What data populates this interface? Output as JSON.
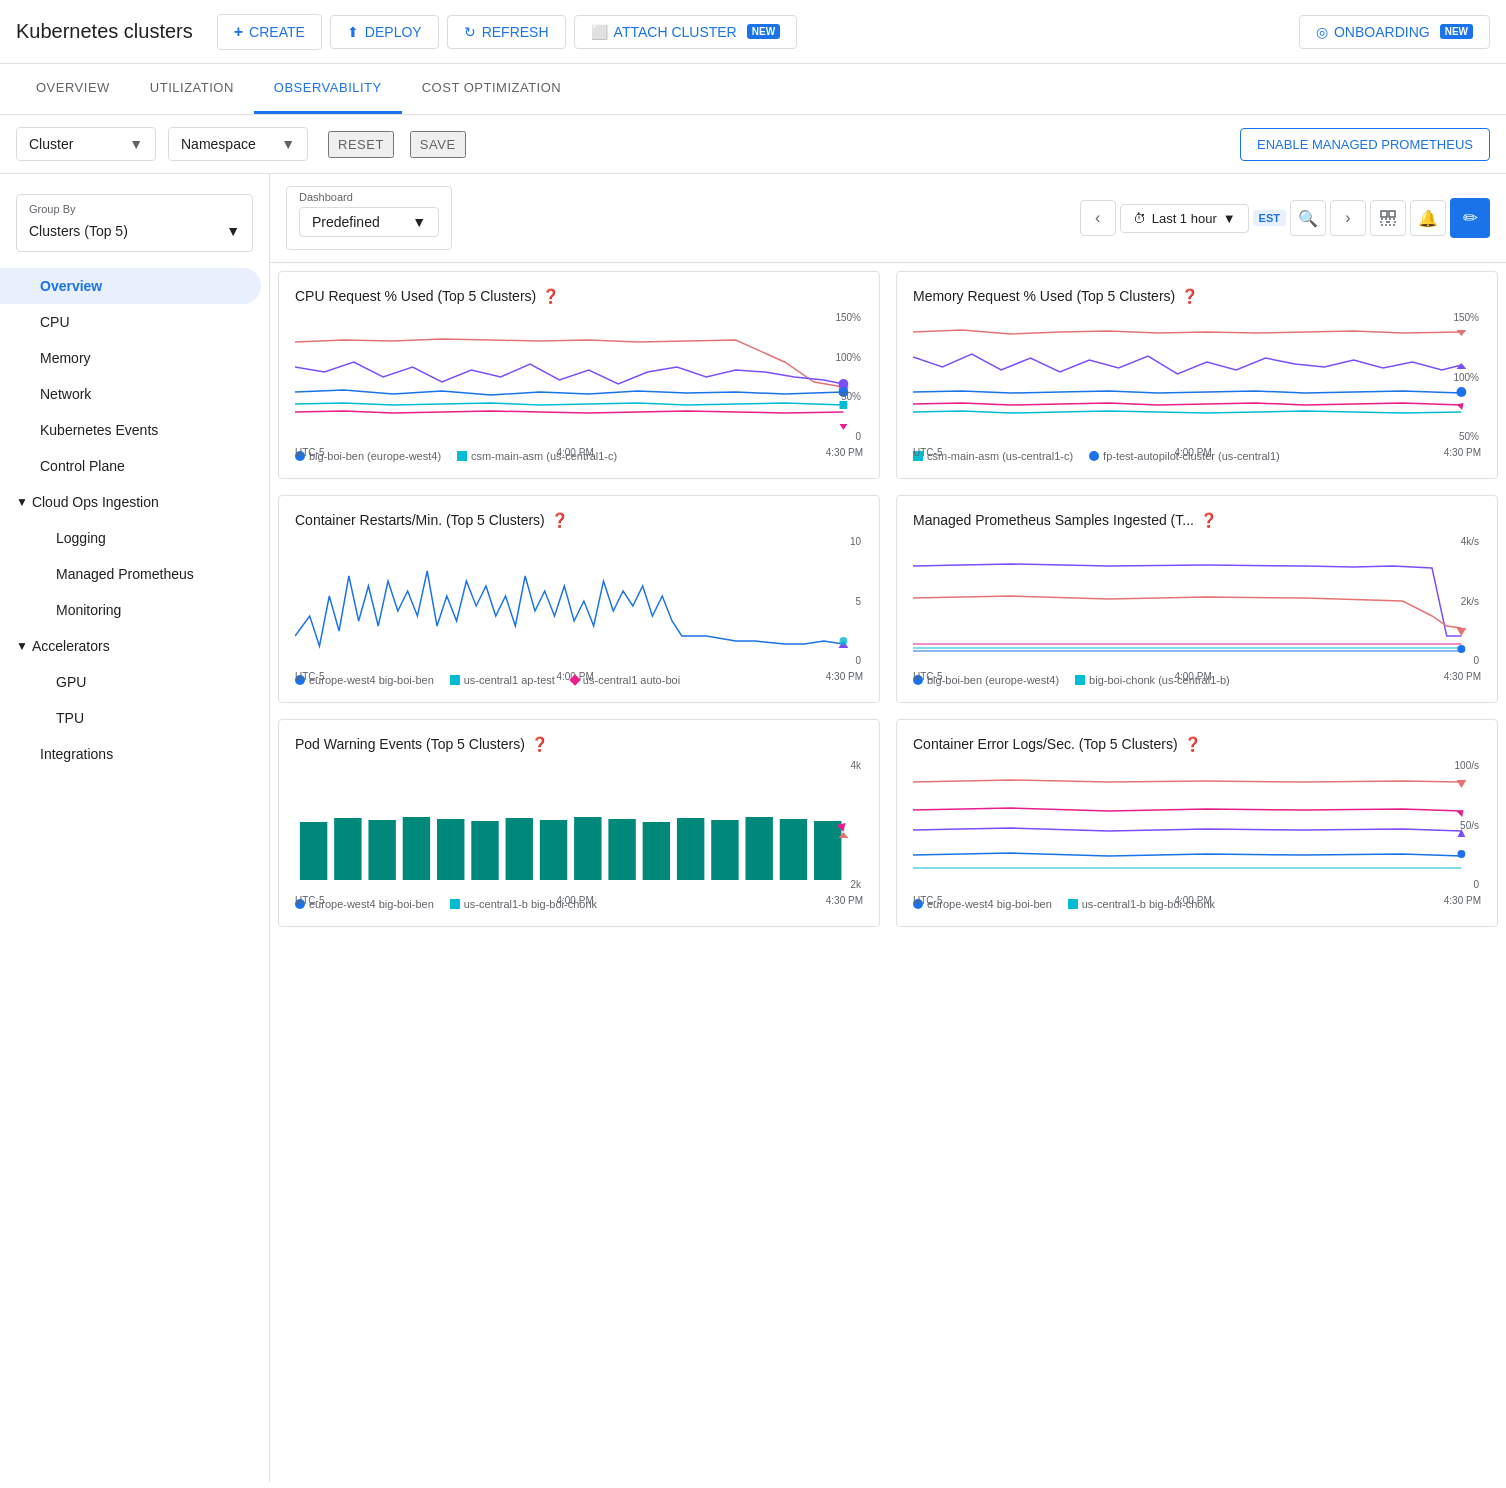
{
  "header": {
    "title": "Kubernetes clusters",
    "buttons": {
      "create": "CREATE",
      "deploy": "DEPLOY",
      "refresh": "REFRESH",
      "attach_cluster": "ATTACH CLUSTER",
      "onboarding": "ONBOARDING"
    },
    "new_badges": [
      "attach_cluster",
      "onboarding"
    ]
  },
  "tabs": [
    {
      "id": "overview",
      "label": "OVERVIEW",
      "active": false
    },
    {
      "id": "utilization",
      "label": "UTILIZATION",
      "active": false
    },
    {
      "id": "observability",
      "label": "OBSERVABILITY",
      "active": true
    },
    {
      "id": "cost_optimization",
      "label": "COST OPTIMIZATION",
      "active": false
    }
  ],
  "filters": {
    "cluster_label": "Cluster",
    "namespace_label": "Namespace",
    "reset_label": "RESET",
    "save_label": "SAVE",
    "enable_btn": "ENABLE MANAGED PROMETHEUS"
  },
  "sidebar": {
    "group_by_label": "Group By",
    "group_by_value": "Clusters (Top 5)",
    "nav_items": [
      {
        "id": "overview",
        "label": "Overview",
        "active": true,
        "indent": 1
      },
      {
        "id": "cpu",
        "label": "CPU",
        "active": false,
        "indent": 1
      },
      {
        "id": "memory",
        "label": "Memory",
        "active": false,
        "indent": 1
      },
      {
        "id": "network",
        "label": "Network",
        "active": false,
        "indent": 1
      },
      {
        "id": "kubernetes_events",
        "label": "Kubernetes Events",
        "active": false,
        "indent": 1
      },
      {
        "id": "control_plane",
        "label": "Control Plane",
        "active": false,
        "indent": 1
      },
      {
        "id": "cloud_ops_ingestion",
        "label": "Cloud Ops Ingestion",
        "active": false,
        "indent": 0,
        "expandable": true,
        "expanded": true
      },
      {
        "id": "logging",
        "label": "Logging",
        "active": false,
        "indent": 2
      },
      {
        "id": "managed_prometheus",
        "label": "Managed Prometheus",
        "active": false,
        "indent": 2
      },
      {
        "id": "monitoring",
        "label": "Monitoring",
        "active": false,
        "indent": 2
      },
      {
        "id": "accelerators",
        "label": "Accelerators",
        "active": false,
        "indent": 0,
        "expandable": true,
        "expanded": true
      },
      {
        "id": "gpu",
        "label": "GPU",
        "active": false,
        "indent": 2
      },
      {
        "id": "tpu",
        "label": "TPU",
        "active": false,
        "indent": 2
      },
      {
        "id": "integrations",
        "label": "Integrations",
        "active": false,
        "indent": 1
      }
    ]
  },
  "dashboard": {
    "dashboard_label": "Dashboard",
    "dashboard_value": "Predefined",
    "time_range": "Last 1 hour",
    "timezone": "EST"
  },
  "charts": [
    {
      "id": "cpu_request",
      "title": "CPU Request % Used (Top 5 Clusters)",
      "y_max": "150%",
      "y_mid": "100%",
      "y_low": "50%",
      "y_zero": "0",
      "x_labels": [
        "UTC-5",
        "4:00 PM",
        "4:30 PM"
      ],
      "legend": [
        {
          "label": "big-boi-ben (europe-west4)",
          "color": "#1a73e8",
          "shape": "circle"
        },
        {
          "label": "csm-main-asm (us-central1-c)",
          "color": "#00bcd4",
          "shape": "square"
        }
      ]
    },
    {
      "id": "memory_request",
      "title": "Memory Request % Used (Top 5 Clusters)",
      "y_max": "150%",
      "y_mid": "100%",
      "y_low": "50%",
      "x_labels": [
        "UTC-5",
        "4:00 PM",
        "4:30 PM"
      ],
      "legend": [
        {
          "label": "csm-main-asm (us-central1-c)",
          "color": "#00bcd4",
          "shape": "square"
        },
        {
          "label": "fp-test-autopilot-cluster (us-central1)",
          "color": "#1a73e8",
          "shape": "circle"
        }
      ]
    },
    {
      "id": "container_restarts",
      "title": "Container Restarts/Min. (Top 5 Clusters)",
      "y_max": "10",
      "y_mid": "5",
      "y_zero": "0",
      "x_labels": [
        "UTC-5",
        "4:00 PM",
        "4:30 PM"
      ],
      "legend": [
        {
          "label": "europe-west4 big-boi-ben",
          "color": "#1a73e8",
          "shape": "circle"
        },
        {
          "label": "us-central1 ap-test",
          "color": "#00bcd4",
          "shape": "square"
        },
        {
          "label": "us-central1 auto-boi",
          "color": "#e91e8c",
          "shape": "diamond"
        }
      ]
    },
    {
      "id": "managed_prometheus_samples",
      "title": "Managed Prometheus Samples Ingested (T...",
      "y_max": "4k/s",
      "y_mid": "2k/s",
      "y_zero": "0",
      "x_labels": [
        "UTC-5",
        "4:00 PM",
        "4:30 PM"
      ],
      "legend": [
        {
          "label": "big-boi-ben (europe-west4)",
          "color": "#1a73e8",
          "shape": "circle"
        },
        {
          "label": "big-boi-chonk (us-central1-b)",
          "color": "#00bcd4",
          "shape": "square"
        }
      ]
    },
    {
      "id": "pod_warning_events",
      "title": "Pod Warning Events (Top 5 Clusters)",
      "y_max": "4k",
      "y_mid": "2k",
      "x_labels": [
        "UTC-5",
        "4:00 PM",
        "4:30 PM"
      ],
      "legend": [
        {
          "label": "europe-west4 big-boi-ben",
          "color": "#1a73e8",
          "shape": "circle"
        },
        {
          "label": "us-central1-b big-boi-chonk",
          "color": "#00bcd4",
          "shape": "square"
        }
      ]
    },
    {
      "id": "container_error_logs",
      "title": "Container Error Logs/Sec. (Top 5 Clusters)",
      "y_max": "100/s",
      "y_mid": "50/s",
      "y_zero": "0",
      "x_labels": [
        "UTC-5",
        "4:00 PM",
        "4:30 PM"
      ],
      "legend": [
        {
          "label": "europe-west4 big-boi-ben",
          "color": "#1a73e8",
          "shape": "circle"
        },
        {
          "label": "us-central1-b big-boi-chonk",
          "color": "#00bcd4",
          "shape": "square"
        }
      ]
    }
  ]
}
